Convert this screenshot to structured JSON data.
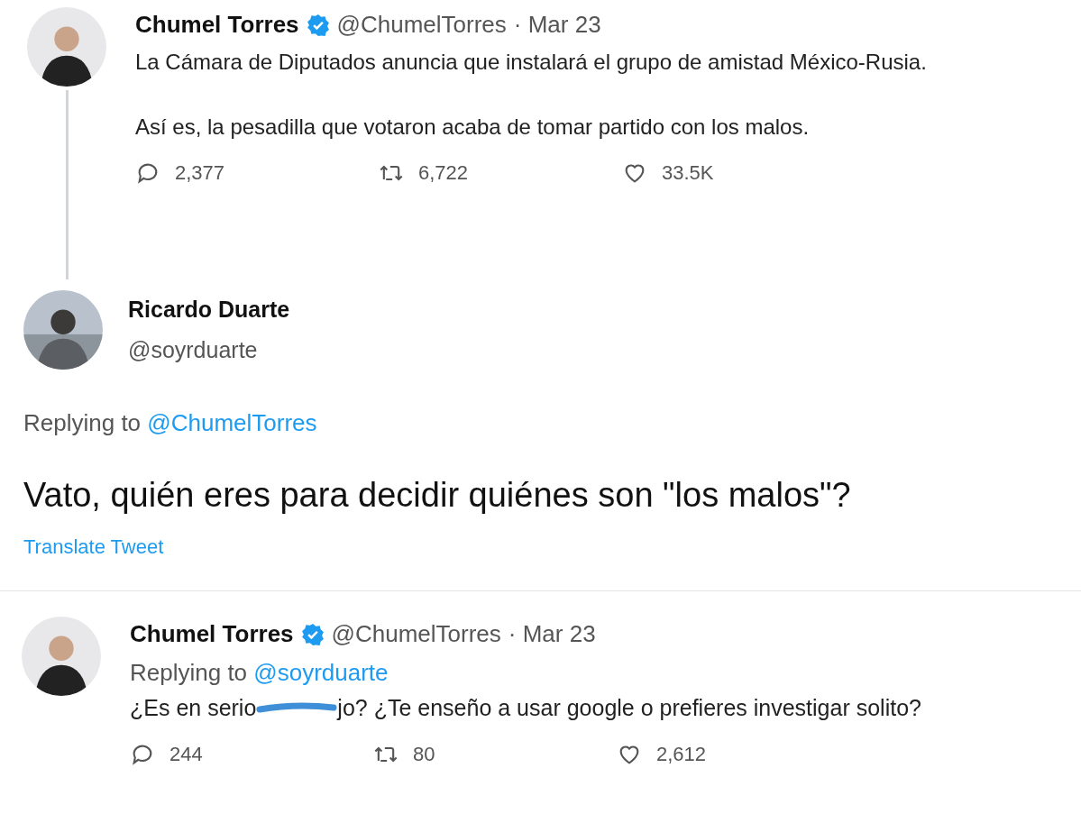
{
  "tweets": [
    {
      "kind": "thread",
      "name": "Chumel Torres",
      "verified": true,
      "handle": "@ChumelTorres",
      "date": "· Mar 23",
      "paragraphs": [
        "La Cámara de Diputados anuncia que instalará el grupo de amistad México-Rusia.",
        "Así es, la pesadilla que votaron acaba de tomar partido con los malos."
      ],
      "stats": [
        "2,377",
        "6,722",
        "33.5K"
      ]
    },
    {
      "kind": "focus",
      "name": "Ricardo Duarte",
      "verified": false,
      "handle": "@soyrduarte",
      "replying_label": "Replying to",
      "replying_to": "@ChumelTorres",
      "text": "Vato, quién eres para decidir quiénes son \"los malos\"?",
      "translate": "Translate Tweet"
    },
    {
      "kind": "reply",
      "name": "Chumel Torres",
      "verified": true,
      "handle": "@ChumelTorres",
      "date": "· Mar 23",
      "replying_label": "Replying to",
      "replying_to": "@soyrduarte",
      "text_before": "¿Es en serio",
      "text_after": "jo? ¿Te enseño a usar google o prefieres investigar solito?",
      "stats": [
        "244",
        "80",
        "2,612"
      ]
    }
  ]
}
